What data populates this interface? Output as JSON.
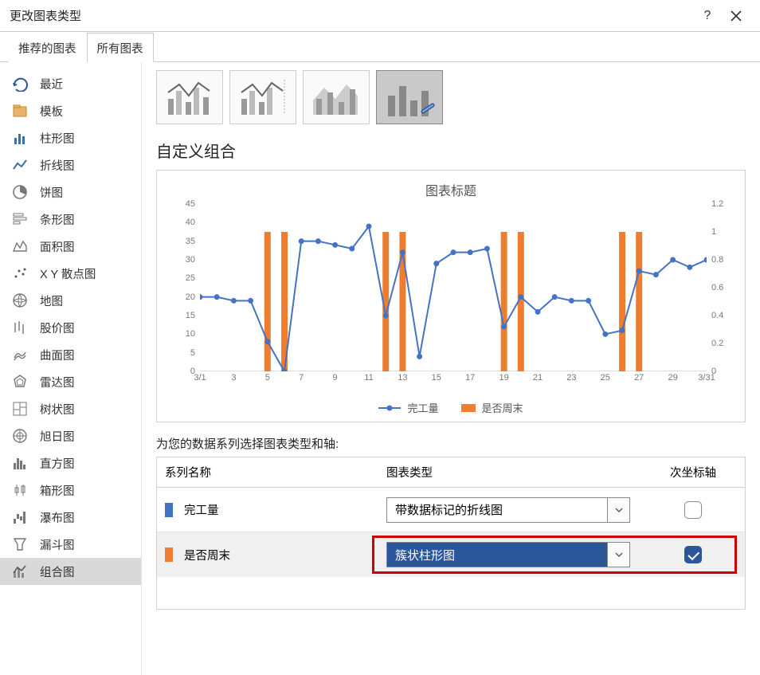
{
  "title": "更改图表类型",
  "tabs": {
    "recommended": "推荐的图表",
    "all": "所有图表"
  },
  "sidebar": [
    {
      "key": "recent",
      "label": "最近"
    },
    {
      "key": "template",
      "label": "模板"
    },
    {
      "key": "column",
      "label": "柱形图"
    },
    {
      "key": "line",
      "label": "折线图"
    },
    {
      "key": "pie",
      "label": "饼图"
    },
    {
      "key": "bar",
      "label": "条形图"
    },
    {
      "key": "area",
      "label": "面积图"
    },
    {
      "key": "scatter",
      "label": "X Y 散点图"
    },
    {
      "key": "map",
      "label": "地图"
    },
    {
      "key": "stock",
      "label": "股价图"
    },
    {
      "key": "surface",
      "label": "曲面图"
    },
    {
      "key": "radar",
      "label": "雷达图"
    },
    {
      "key": "treemap",
      "label": "树状图"
    },
    {
      "key": "sunburst",
      "label": "旭日图"
    },
    {
      "key": "histogram",
      "label": "直方图"
    },
    {
      "key": "boxwhisker",
      "label": "箱形图"
    },
    {
      "key": "waterfall",
      "label": "瀑布图"
    },
    {
      "key": "funnel",
      "label": "漏斗图"
    },
    {
      "key": "combo",
      "label": "组合图"
    }
  ],
  "subtypes": {
    "count": 4,
    "selected": 3
  },
  "section_title": "自定义组合",
  "chart": {
    "title": "图表标题",
    "legend": {
      "a": "完工量",
      "b": "是否周末"
    }
  },
  "series_prompt": "为您的数据系列选择图表类型和轴:",
  "columns": {
    "name": "系列名称",
    "type": "图表类型",
    "secondary": "次坐标轴"
  },
  "rows": [
    {
      "name": "完工量",
      "type": "带数据标记的折线图",
      "secondary": false,
      "swatch": "blue"
    },
    {
      "name": "是否周末",
      "type": "簇状柱形图",
      "secondary": true,
      "swatch": "orange",
      "selected": true
    }
  ],
  "chart_data": {
    "type": "combo",
    "title": "图表标题",
    "x_ticks": [
      "3/1",
      "3",
      "5",
      "7",
      "9",
      "11",
      "13",
      "15",
      "17",
      "19",
      "21",
      "23",
      "25",
      "27",
      "29",
      "3/31"
    ],
    "y_left": {
      "min": 0,
      "max": 45,
      "step": 5,
      "label": ""
    },
    "y_right": {
      "min": 0,
      "max": 1.2,
      "step": 0.2,
      "label": ""
    },
    "series": [
      {
        "name": "完工量",
        "type": "line_markers",
        "axis": "left",
        "color": "#4472c4",
        "x": [
          1,
          2,
          3,
          4,
          5,
          6,
          7,
          8,
          9,
          10,
          11,
          12,
          13,
          14,
          15,
          16,
          17,
          18,
          19,
          20,
          21,
          22,
          23,
          24,
          25,
          26,
          27,
          28,
          29,
          30,
          31
        ],
        "y": [
          20,
          20,
          19,
          19,
          8,
          0,
          35,
          35,
          34,
          33,
          39,
          15,
          32,
          4,
          29,
          32,
          32,
          33,
          12,
          20,
          16,
          20,
          19,
          19,
          10,
          11,
          27,
          26,
          30,
          28,
          30
        ]
      },
      {
        "name": "是否周末",
        "type": "bar",
        "axis": "right",
        "color": "#ed7d31",
        "x": [
          5,
          6,
          12,
          13,
          19,
          20,
          26,
          27
        ],
        "y": [
          1,
          1,
          1,
          1,
          1,
          1,
          1,
          1
        ]
      }
    ]
  }
}
